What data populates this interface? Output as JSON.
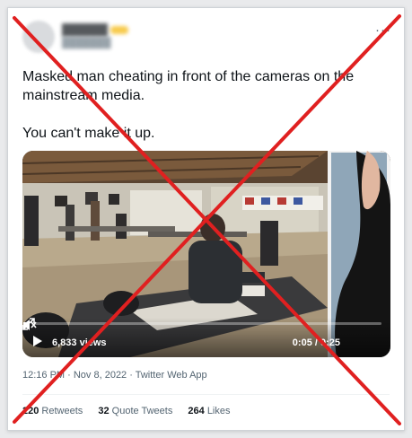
{
  "tweet": {
    "text_lines": [
      "Masked man cheating in front of the cameras on the mainstream media.",
      "You can't make it up."
    ],
    "more_label": "···"
  },
  "video": {
    "views": "6,833 views",
    "time": "0:05 / 0:25"
  },
  "meta": {
    "timestamp": "12:16 PM · Nov 8, 2022 · Twitter Web App"
  },
  "stats": {
    "retweets_count": "220",
    "retweets_label": "Retweets",
    "quotes_count": "32",
    "quotes_label": "Quote Tweets",
    "likes_count": "264",
    "likes_label": "Likes"
  },
  "colors": {
    "cross": "#e02020",
    "text": "#0f1419",
    "muted": "#536471"
  }
}
